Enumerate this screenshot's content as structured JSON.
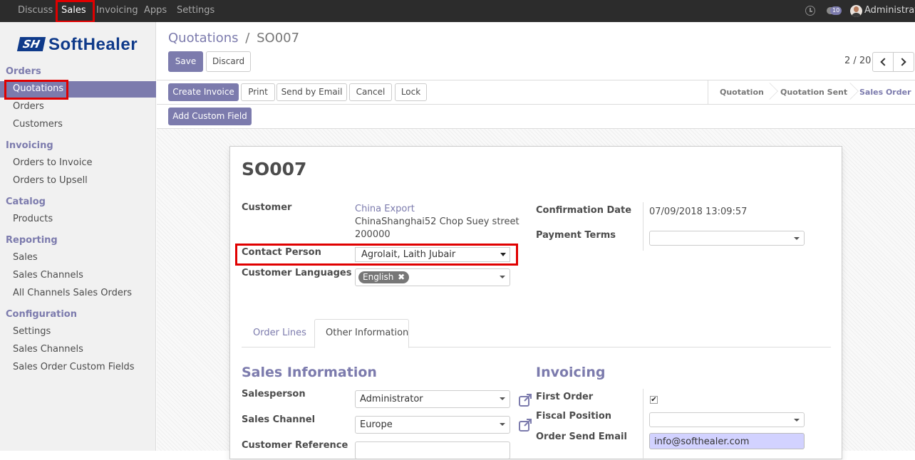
{
  "topbar": {
    "menu": [
      "Discuss",
      "Sales",
      "Invoicing",
      "Apps",
      "Settings"
    ],
    "active_index": 1,
    "message_count": "10",
    "user": "Administrator"
  },
  "sidebar": {
    "logo_text": "SoftHealer",
    "sections": [
      {
        "title": "Orders",
        "items": [
          "Quotations",
          "Orders",
          "Customers"
        ]
      },
      {
        "title": "Invoicing",
        "items": [
          "Orders to Invoice",
          "Orders to Upsell"
        ]
      },
      {
        "title": "Catalog",
        "items": [
          "Products"
        ]
      },
      {
        "title": "Reporting",
        "items": [
          "Sales",
          "Sales Channels",
          "All Channels Sales Orders"
        ]
      },
      {
        "title": "Configuration",
        "items": [
          "Settings",
          "Sales Channels",
          "Sales Order Custom Fields"
        ]
      }
    ]
  },
  "breadcrumb": {
    "parent": "Quotations",
    "separator": "/",
    "current": "SO007"
  },
  "control": {
    "save": "Save",
    "discard": "Discard",
    "pager": "2 / 20"
  },
  "statusbar": {
    "buttons": [
      "Create Invoice",
      "Print",
      "Send by Email",
      "Cancel",
      "Lock"
    ],
    "stages": [
      "Quotation",
      "Quotation Sent",
      "Sales Order"
    ],
    "active_stage": "Sales Order",
    "add_custom_field": "Add Custom Field"
  },
  "form": {
    "title": "SO007",
    "customer_label": "Customer",
    "customer_name": "China Export",
    "customer_address_1": "ChinaShanghai52 Chop Suey street",
    "customer_address_2": "200000",
    "contact_label": "Contact Person",
    "contact_value": "Agrolait, Laith Jubair",
    "languages_label": "Customer Languages",
    "language_tag": "English",
    "confirmation_date_label": "Confirmation Date",
    "confirmation_date": "07/09/2018 13:09:57",
    "payment_terms_label": "Payment Terms",
    "payment_terms_value": "",
    "tabs": [
      "Order Lines",
      "Other Information"
    ],
    "active_tab": "Other Information",
    "sales_info_title": "Sales Information",
    "salesperson_label": "Salesperson",
    "salesperson": "Administrator",
    "sales_channel_label": "Sales Channel",
    "sales_channel": "Europe",
    "customer_reference_label": "Customer Reference",
    "customer_reference": "",
    "invoicing_title": "Invoicing",
    "first_order_label": "First Order",
    "first_order_checked": true,
    "fiscal_position_label": "Fiscal Position",
    "fiscal_position": "",
    "order_send_email_label": "Order Send Email",
    "order_send_email": "info@softhealer.com"
  },
  "colors": {
    "accent": "#7c7bad",
    "highlight": "#e00000",
    "topbar": "#2c2c2c",
    "email_bg": "#d2d2ff"
  }
}
